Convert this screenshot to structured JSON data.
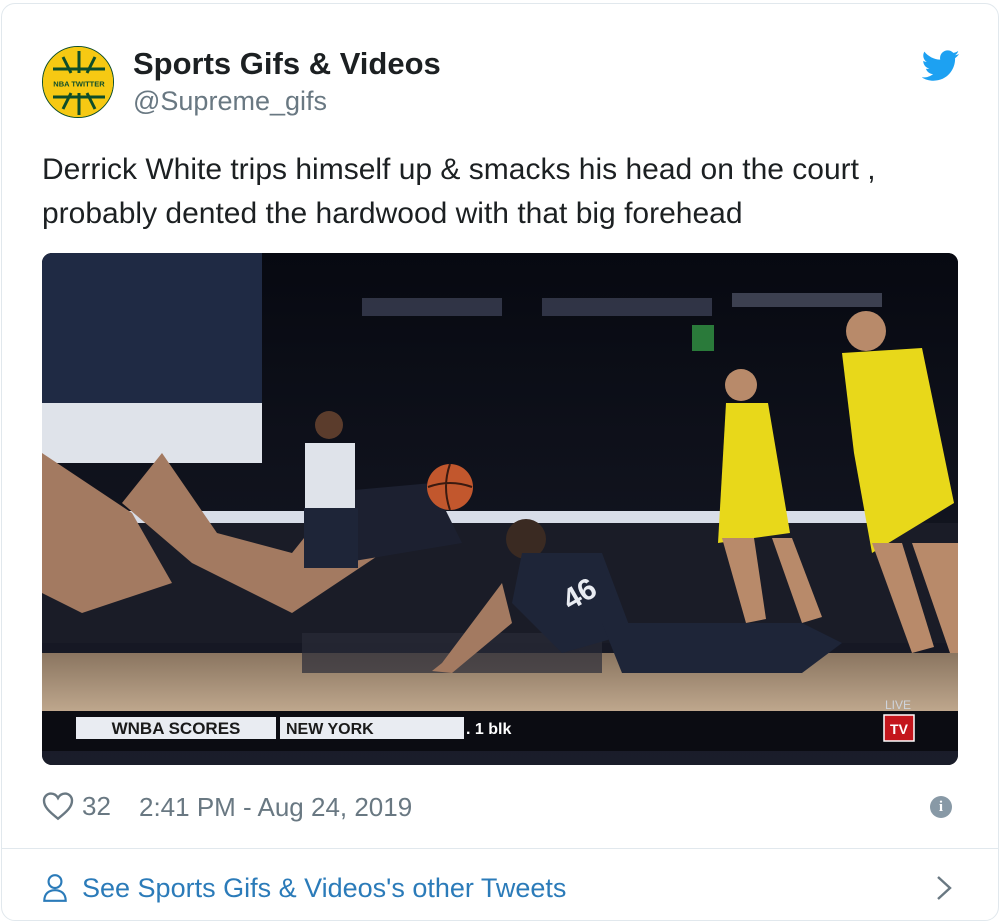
{
  "author": {
    "display_name": "Sports Gifs & Videos",
    "handle": "@Supreme_gifs",
    "avatar_text": "NBA TWITTER",
    "avatar_colors": {
      "primary": "#f6c913",
      "secondary": "#0d4d2a"
    }
  },
  "tweet": {
    "text": "Derrick White trips himself up & smacks his head on the court ,\nprobably dented the hardwood with that big forehead"
  },
  "media": {
    "scoreboard": {
      "label": "WNBA SCORES",
      "team": "NEW YORK",
      "stat": ". 1 blk",
      "live": "LIVE",
      "network": "TV"
    },
    "jersey_number": "46"
  },
  "footer": {
    "like_count": "32",
    "timestamp": "2:41 PM - Aug 24, 2019"
  },
  "other_tweets": {
    "label": "See Sports Gifs & Videos's other Tweets"
  },
  "colors": {
    "twitter_blue": "#1da1f2",
    "link_blue": "#2b7bb9",
    "muted": "#697882"
  },
  "icons": [
    "twitter-bird-icon",
    "heart-icon",
    "info-icon",
    "person-icon",
    "chevron-right-icon"
  ]
}
